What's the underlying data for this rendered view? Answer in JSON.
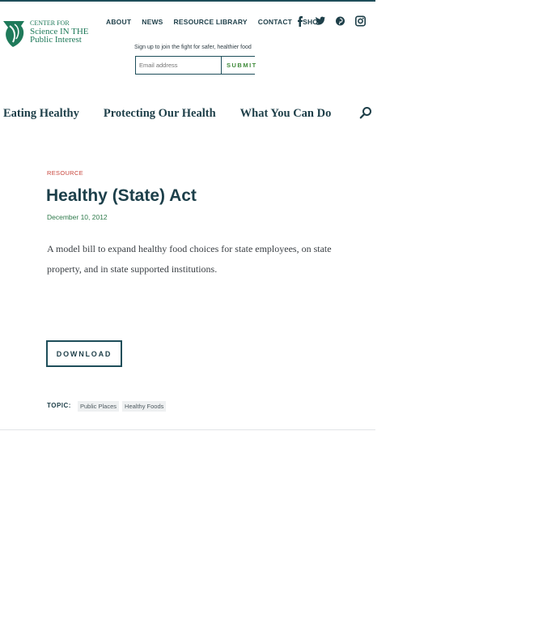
{
  "brand": {
    "line1": "CENTER FOR",
    "line2": "Science IN THE",
    "line3": "Public Interest",
    "color": "#1f7a5a"
  },
  "top_nav": [
    "ABOUT",
    "NEWS",
    "RESOURCE LIBRARY",
    "CONTACT",
    "SHOP"
  ],
  "social_icons": [
    "facebook-icon",
    "twitter-icon",
    "pinterest-icon",
    "instagram-icon"
  ],
  "signup": {
    "prompt": "Sign up to join the fight for safer, healthier food",
    "placeholder": "Email address",
    "button": "SUBMIT"
  },
  "main_nav": [
    "Eating Healthy",
    "Protecting Our Health",
    "What You Can Do"
  ],
  "article": {
    "kicker": "RESOURCE",
    "title": "Healthy (State) Act",
    "date": "December 10, 2012",
    "description": "A model bill to expand healthy food choices for state employees, on state property, and in state supported institutions.",
    "download_label": "DOWNLOAD",
    "topic_label": "TOPIC:",
    "tags": [
      "Public Places",
      "Healthy Foods"
    ]
  },
  "colors": {
    "primary": "#1e4e5a",
    "accent_red": "#c8463c",
    "accent_green": "#2e7a4b"
  }
}
